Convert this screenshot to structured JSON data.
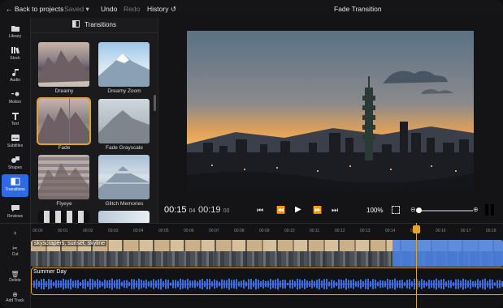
{
  "topbar": {
    "back": "Back to projects",
    "saved": "Saved",
    "undo": "Undo",
    "redo": "Redo",
    "history": "History",
    "title": "Fade Transition"
  },
  "sidebar": {
    "items": [
      {
        "label": "Library",
        "icon": "folder-icon"
      },
      {
        "label": "Stock",
        "icon": "stock-icon"
      },
      {
        "label": "Audio",
        "icon": "music-note-icon"
      },
      {
        "label": "Motion",
        "icon": "motion-icon"
      },
      {
        "label": "Text",
        "icon": "text-icon"
      },
      {
        "label": "Subtitles",
        "icon": "subtitles-icon"
      },
      {
        "label": "Shapes",
        "icon": "shapes-icon"
      },
      {
        "label": "Transitions",
        "icon": "transitions-icon"
      },
      {
        "label": "Reviews",
        "icon": "reviews-icon"
      }
    ]
  },
  "panel": {
    "title": "Transitions",
    "items": [
      {
        "label": "Dreamy"
      },
      {
        "label": "Dreamy Zoom"
      },
      {
        "label": "Fade"
      },
      {
        "label": "Fade Grayscale"
      },
      {
        "label": "Flyeye"
      },
      {
        "label": "Glitch Memories"
      }
    ]
  },
  "player": {
    "current_time": "00:15",
    "current_frame": "04",
    "total_time": "00:19",
    "total_frame": "00",
    "zoom": "100%"
  },
  "timeline": {
    "ticks": [
      "00:00",
      "00:01",
      "00:02",
      "00:03",
      "00:04",
      "00:05",
      "00:06",
      "00:07",
      "00:08",
      "00:09",
      "00:10",
      "00:11",
      "00:12",
      "00:13",
      "00:14",
      "00:15",
      "00:16",
      "00:17",
      "00:18"
    ],
    "video_clip": "skyscrapers, sunset, skyline",
    "audio_clip": "Summer Day",
    "left_buttons": [
      "Cut",
      "Delete",
      "Add Track"
    ]
  },
  "colors": {
    "accent": "#2f6ae6",
    "playhead": "#e0a32c",
    "audio_wave": "#3b6fe0"
  }
}
